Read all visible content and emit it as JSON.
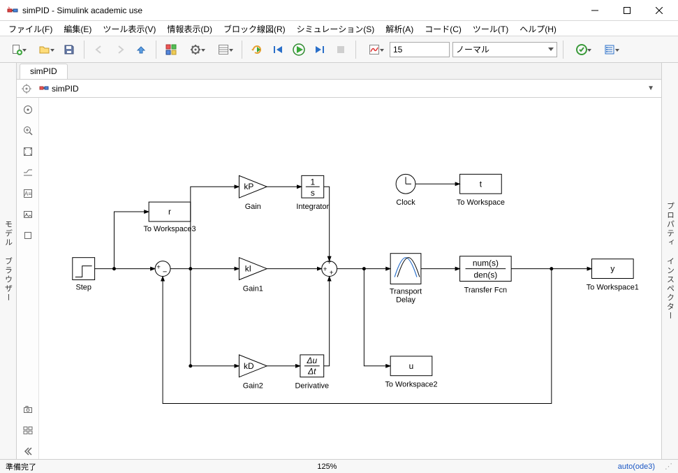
{
  "window": {
    "title": "simPID - Simulink academic use"
  },
  "menu": {
    "file": "ファイル(F)",
    "edit": "編集(E)",
    "tools": "ツール表示(V)",
    "info": "情報表示(D)",
    "block": "ブロック線図(R)",
    "simulation": "シミュレーション(S)",
    "analysis": "解析(A)",
    "code": "コード(C)",
    "tool": "ツール(T)",
    "help": "ヘルプ(H)"
  },
  "toolbar": {
    "stop_time": "15",
    "mode": "ノーマル"
  },
  "tabs": {
    "active": "simPID"
  },
  "breadcrumb": {
    "model": "simPID"
  },
  "sidebars": {
    "left": "モデル ブラウザー",
    "right": "プロパティ インスペクター"
  },
  "status": {
    "ready": "準備完了",
    "zoom": "125%",
    "solver": "auto(ode3)"
  },
  "blocks": {
    "step": {
      "name": "Step"
    },
    "toWorkspace3": {
      "name": "To Workspace3",
      "var": "r"
    },
    "gainP": {
      "name": "Gain",
      "k": "kP"
    },
    "gainI": {
      "name": "Gain1",
      "k": "kI"
    },
    "gainD": {
      "name": "Gain2",
      "k": "kD"
    },
    "integrator": {
      "name": "Integrator",
      "top": "1",
      "bot": "s"
    },
    "derivative": {
      "name": "Derivative",
      "top": "Δu",
      "bot": "Δt"
    },
    "transportDelay": {
      "name": "Transport Delay"
    },
    "transferFcn": {
      "name": "Transfer Fcn",
      "top": "num(s)",
      "bot": "den(s)"
    },
    "toWorkspace1": {
      "name": "To Workspace1",
      "var": "y"
    },
    "toWorkspace2": {
      "name": "To Workspace2",
      "var": "u"
    },
    "toWorkspaceT": {
      "name": "To Workspace",
      "var": "t"
    },
    "clock": {
      "name": "Clock"
    }
  }
}
